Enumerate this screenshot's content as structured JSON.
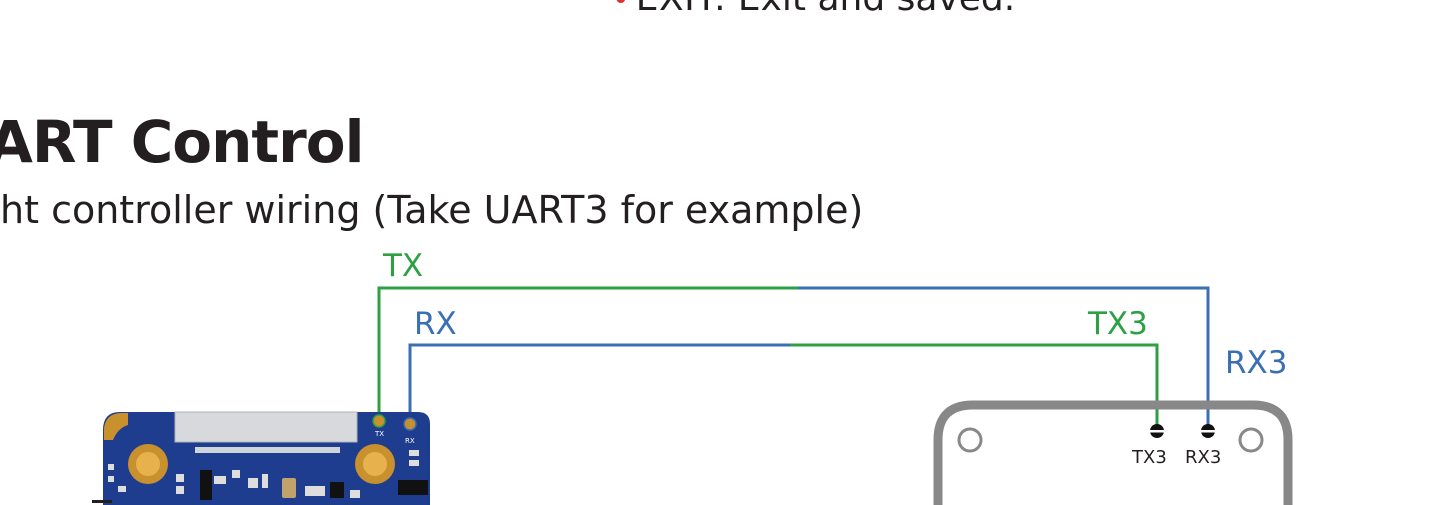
{
  "exit_item": {
    "key": "EXIT:",
    "description": " Exit and saved."
  },
  "section": {
    "title": "ART Control",
    "subtitle": "ht controller wiring (Take UART3 for example)"
  },
  "wiring": {
    "wire_tx_label": "TX",
    "wire_rx_label": "RX",
    "wire_tx3_label": "TX3",
    "wire_rx3_label": "RX3",
    "camera_pad_tx": "TX",
    "camera_pad_rx": "RX",
    "fc_pad_tx3": "TX3",
    "fc_pad_rx3": "RX3"
  },
  "colors": {
    "green_wire": "#2ea043",
    "blue_wire": "#3a6fb4",
    "pcb_blue": "#1f3d8f",
    "gold_pad": "#c8912e",
    "frame_gray": "#888888",
    "bullet_red": "#e03131"
  }
}
